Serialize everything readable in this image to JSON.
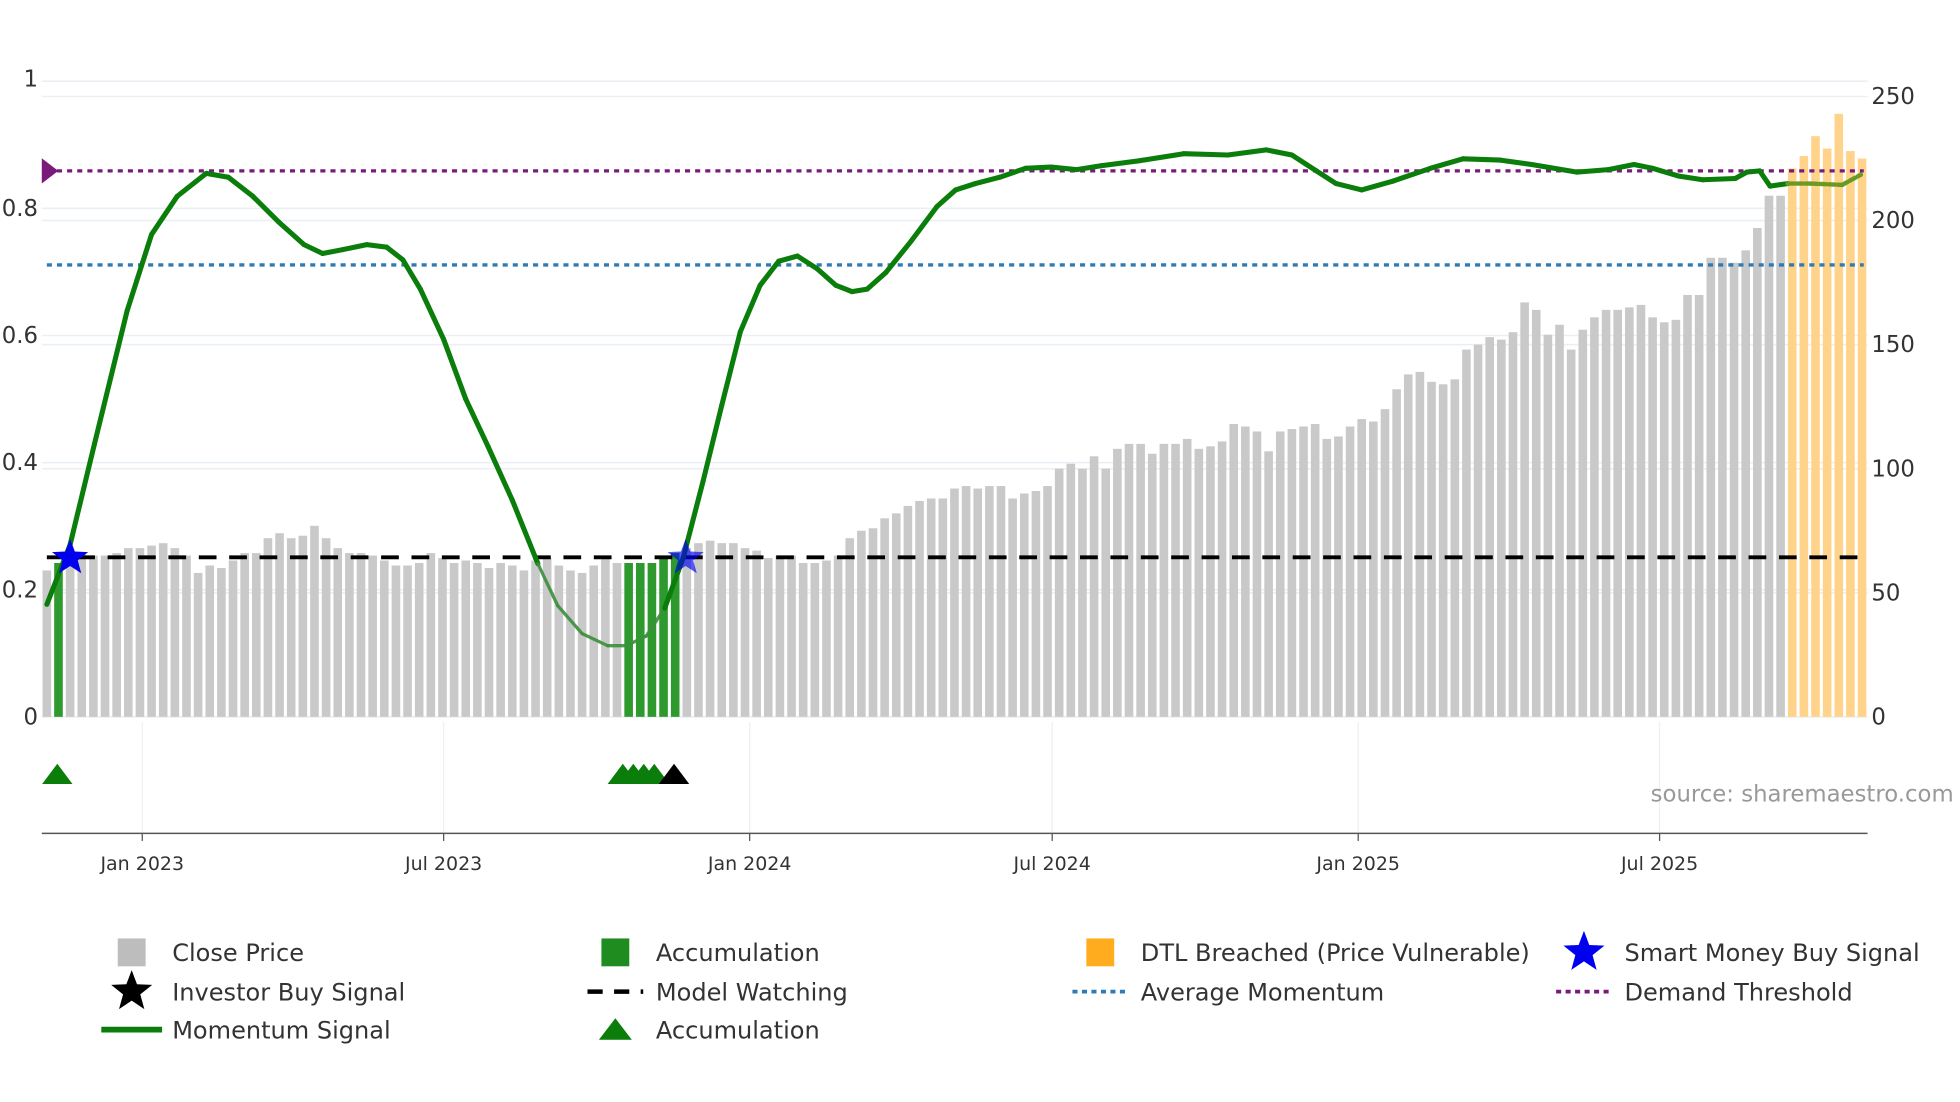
{
  "chart_data": {
    "type": "bar+line",
    "source": "source: sharemaestro.com",
    "x_unit": "week index (weekly bars, ~Nov 2022 to Nov 2025)",
    "x_ticks": [
      {
        "label": "Jan 2023",
        "index": 8.2
      },
      {
        "label": "Jul 2023",
        "index": 34.1
      },
      {
        "label": "Jan 2024",
        "index": 60.4
      },
      {
        "label": "Jul 2024",
        "index": 86.4
      },
      {
        "label": "Jan 2025",
        "index": 112.7
      },
      {
        "label": "Jul 2025",
        "index": 138.6
      }
    ],
    "left_axis": {
      "range": [
        0,
        1
      ],
      "ticks": [
        "0",
        "0.2",
        "0.4",
        "0.6",
        "0.8",
        "1"
      ],
      "tick_values": [
        0,
        0.2,
        0.4,
        0.6,
        0.8,
        1
      ]
    },
    "right_axis": {
      "range": [
        0,
        256
      ],
      "ticks": [
        "0",
        "50",
        "100",
        "150",
        "200",
        "250"
      ],
      "tick_values": [
        0,
        50,
        100,
        150,
        200,
        250
      ]
    },
    "close_price": [
      59,
      62,
      64,
      66,
      65,
      65,
      66,
      68,
      68,
      69,
      70,
      68,
      65,
      58,
      61,
      60,
      63,
      66,
      66,
      72,
      74,
      72,
      73,
      77,
      72,
      68,
      66,
      66,
      65,
      63,
      61,
      61,
      62,
      66,
      64,
      62,
      63,
      62,
      60,
      62,
      61,
      59,
      63,
      64,
      61,
      59,
      58,
      61,
      65,
      62,
      62,
      62,
      62,
      65,
      66,
      68,
      70,
      71,
      70,
      70,
      68,
      67,
      64,
      65,
      65,
      62,
      62,
      63,
      65,
      72,
      75,
      76,
      80,
      82,
      85,
      87,
      88,
      88,
      92,
      93,
      92,
      93,
      93,
      88,
      90,
      91,
      93,
      100,
      102,
      100,
      105,
      100,
      108,
      110,
      110,
      106,
      110,
      110,
      112,
      108,
      109,
      111,
      118,
      117,
      115,
      107,
      115,
      116,
      117,
      118,
      112,
      113,
      117,
      120,
      119,
      124,
      132,
      138,
      139,
      135,
      134,
      136,
      148,
      150,
      153,
      152,
      155,
      167,
      164,
      154,
      158,
      148,
      156,
      161,
      164,
      164,
      165,
      166,
      161,
      159,
      160,
      170,
      170,
      185,
      185,
      183,
      188,
      197,
      210,
      210,
      221,
      226,
      234,
      229,
      243,
      228,
      225
    ],
    "accumulation_bars": [
      1,
      50,
      51,
      52,
      53,
      54
    ],
    "dtl_breached_bars": [
      150,
      151,
      152,
      153,
      154,
      155,
      156
    ],
    "momentum": {
      "index": [
        0,
        2,
        4.1,
        6.9,
        9,
        11.2,
        13.7,
        15.6,
        17.7,
        19.9,
        22.1,
        23.7,
        25.4,
        27.5,
        29.2,
        30.6,
        32.1,
        34.1,
        36,
        37.9,
        40,
        42.2,
        43.9,
        46,
        48.2,
        49.8,
        51.5,
        53.1,
        54.7,
        56.4,
        58,
        59.6,
        61.3,
        62.9,
        64.5,
        66.2,
        67.8,
        69.2,
        70.5,
        72.1,
        74.3,
        76.5,
        78.1,
        79.8,
        81.9,
        84.1,
        86.3,
        88.5,
        90.6,
        93.9,
        97.7,
        101.5,
        104.8,
        107,
        109.1,
        110.8,
        113,
        115.7,
        118.9,
        121.7,
        124.9,
        127.6,
        131.5,
        134.2,
        136.4,
        138,
        140.2,
        142.3,
        145.1,
        146.1,
        147.2,
        148.1,
        149.6,
        151.6,
        154.3,
        155.9
      ],
      "values": [
        0.177,
        0.271,
        0.43,
        0.639,
        0.759,
        0.819,
        0.855,
        0.849,
        0.819,
        0.779,
        0.743,
        0.729,
        0.735,
        0.743,
        0.739,
        0.719,
        0.673,
        0.594,
        0.5,
        0.426,
        0.341,
        0.241,
        0.175,
        0.131,
        0.112,
        0.112,
        0.127,
        0.171,
        0.251,
        0.371,
        0.49,
        0.606,
        0.679,
        0.717,
        0.725,
        0.705,
        0.679,
        0.669,
        0.673,
        0.699,
        0.749,
        0.803,
        0.829,
        0.839,
        0.849,
        0.863,
        0.865,
        0.861,
        0.867,
        0.875,
        0.886,
        0.884,
        0.892,
        0.884,
        0.859,
        0.839,
        0.829,
        0.843,
        0.863,
        0.878,
        0.876,
        0.869,
        0.857,
        0.861,
        0.869,
        0.863,
        0.851,
        0.845,
        0.847,
        0.857,
        0.859,
        0.835,
        0.839,
        0.839,
        0.837,
        0.853
      ]
    },
    "demand_threshold": 0.859,
    "average_momentum": 0.711,
    "model_watching": 0.251,
    "smart_money_buy_signals": [
      {
        "index": 2,
        "value": 0.25
      },
      {
        "index": 54.9,
        "value": 0.25
      }
    ],
    "accumulation_markers": [
      0.9,
      49.5,
      50.4,
      51.3,
      52.2
    ],
    "investor_buy_signals": [
      53.9
    ],
    "legend": [
      {
        "label": "Close Price",
        "color": "#bdbdbd",
        "symbol": "square"
      },
      {
        "label": "Accumulation",
        "color": "#1e8c1e",
        "symbol": "square"
      },
      {
        "label": "DTL Breached (Price Vulnerable)",
        "color": "#ffad1f",
        "symbol": "square"
      },
      {
        "label": "Smart Money Buy Signal",
        "color": "#0000ee",
        "symbol": "star"
      },
      {
        "label": "Investor Buy Signal",
        "color": "#000000",
        "symbol": "star"
      },
      {
        "label": "Model Watching",
        "color": "#000000",
        "symbol": "dash"
      },
      {
        "label": "Average Momentum",
        "color": "#2f7bb5",
        "symbol": "dot"
      },
      {
        "label": "Demand Threshold",
        "color": "#7a1a7a",
        "symbol": "dot"
      },
      {
        "label": "Momentum Signal",
        "color": "#0a7d0a",
        "symbol": "line"
      },
      {
        "label": "Accumulation",
        "color": "#0a7d0a",
        "symbol": "triangle"
      }
    ],
    "legend_placement": "bottom"
  }
}
